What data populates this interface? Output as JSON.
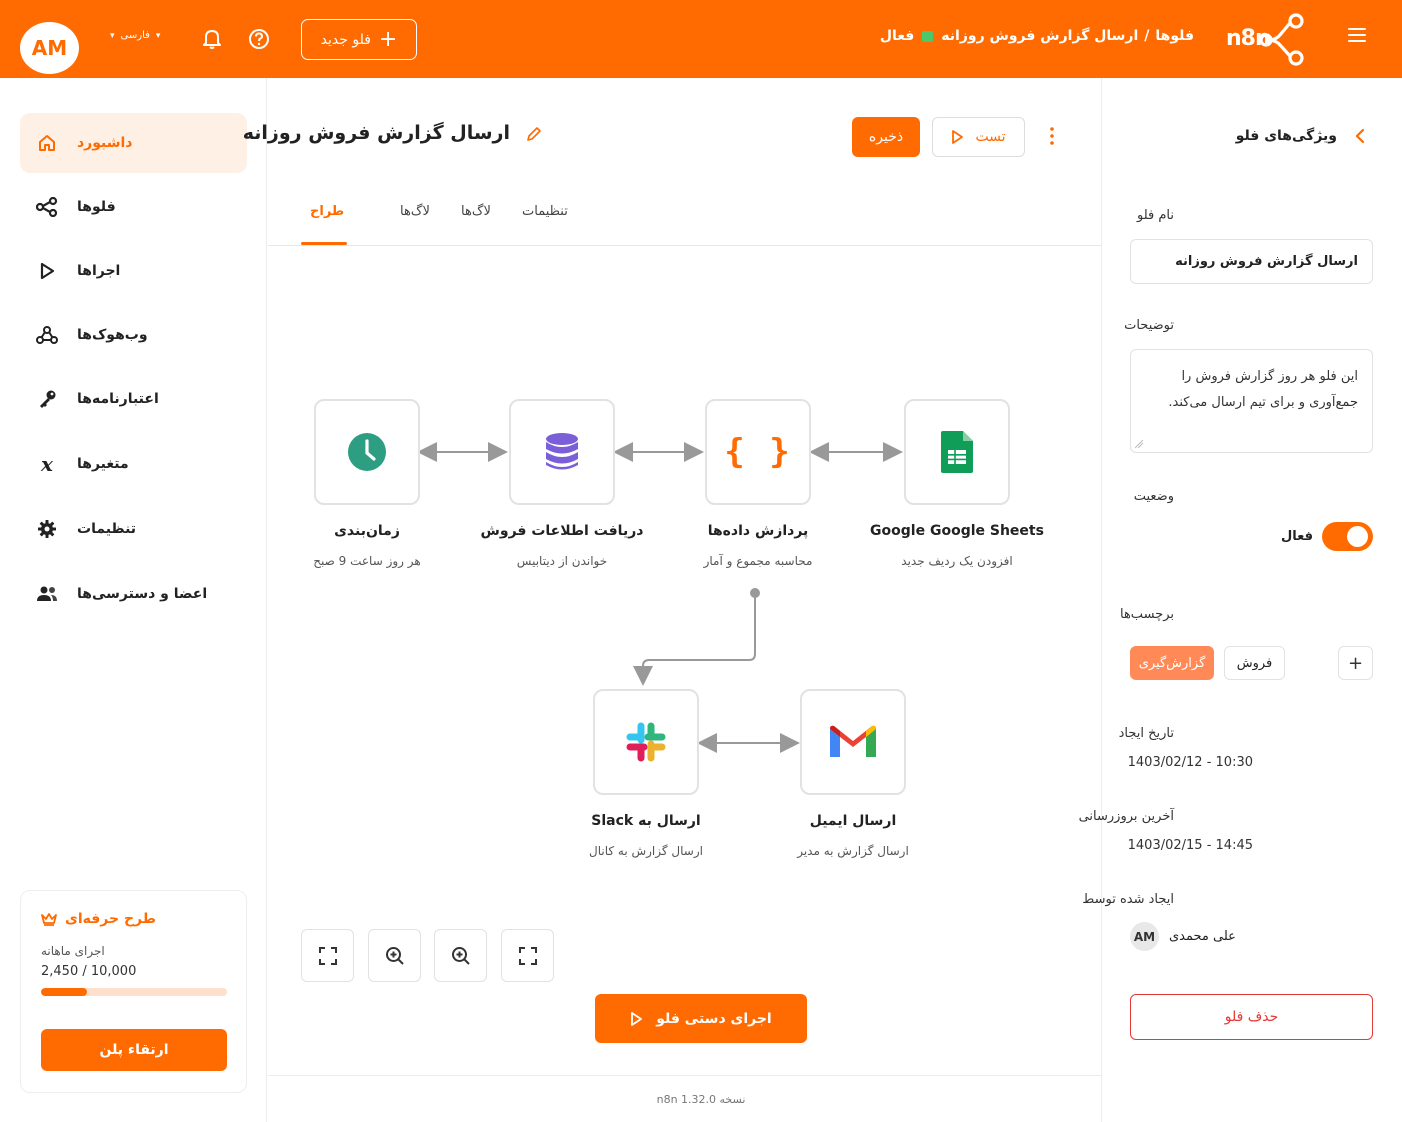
{
  "topbar": {
    "avatar_initials": "AM",
    "lang_label": "فارسی",
    "new_flow_label": "فلو جدید",
    "breadcrumb_parent": "فلوها",
    "breadcrumb_sep": "/",
    "breadcrumb_current": "ارسال گزارش فروش روزانه",
    "status_label": "فعال",
    "logo_text": "n8n",
    "icons": [
      "menu-icon",
      "bell-icon",
      "help-icon",
      "chevron-down-icon",
      "plus-icon"
    ]
  },
  "sidebar": {
    "items": [
      {
        "label": "داشبورد",
        "icon": "home-icon",
        "active": true
      },
      {
        "label": "فلوها",
        "icon": "share-icon"
      },
      {
        "label": "اجراها",
        "icon": "play-icon"
      },
      {
        "label": "وب‌هوک‌ها",
        "icon": "webhook-icon"
      },
      {
        "label": "اعتبارنامه‌ها",
        "icon": "key-icon"
      },
      {
        "label": "متغیرها",
        "icon": "variable-icon"
      },
      {
        "label": "تنظیمات",
        "icon": "gear-icon"
      },
      {
        "label": "اعضا و دسترسی‌ها",
        "icon": "users-icon"
      }
    ],
    "plan": {
      "title": "طرح حرفه‌ای",
      "subtitle": "اجرای ماهانه",
      "usage_text": "2,450 / 10,000",
      "usage_fraction": 0.245,
      "upgrade_label": "ارتقاء پلن"
    }
  },
  "main": {
    "flow_title": "ارسال گزارش فروش روزانه",
    "test_label": "تست",
    "save_label": "ذخیره",
    "tabs": [
      {
        "label": "طراح",
        "active": true
      },
      {
        "label": "لاگ‌ها"
      },
      {
        "label": "لاگ‌ها"
      },
      {
        "label": "تنظیمات"
      }
    ],
    "nodes": [
      {
        "title": "زمان‌بندی",
        "subtitle": "هر روز ساعت 9 صبح",
        "icon": "clock-icon"
      },
      {
        "title": "دریافت اطلاعات فروش",
        "subtitle": "خواندن از دیتابیس",
        "icon": "database-icon"
      },
      {
        "title": "پردازش داده‌ها",
        "subtitle": "محاسبه مجموع و آمار",
        "icon": "code-braces-icon"
      },
      {
        "title": "Google Google Sheets",
        "subtitle": "افزودن یک ردیف جدید",
        "icon": "google-sheets-icon"
      },
      {
        "title": "ارسال به Slack",
        "subtitle": "ارسال گزارش به کانال",
        "icon": "slack-icon"
      },
      {
        "title": "ارسال ایمیل",
        "subtitle": "ارسال گزارش به مدیر",
        "icon": "gmail-icon"
      }
    ],
    "zoom_controls": [
      "fit-view-icon",
      "zoom-in-icon",
      "zoom-out-icon",
      "fullscreen-icon"
    ],
    "run_label": "اجرای دستی فلو",
    "version_text": "نسخه n8n 1.32.0"
  },
  "props": {
    "title": "ویژگی‌های فلو",
    "name_label": "نام فلو",
    "name_value": "ارسال گزارش فروش روزانه",
    "desc_label": "توضیحات",
    "desc_line1": "این فلو هر روز گزارش فروش را",
    "desc_line2": "جمع‌آوری و برای تیم ارسال می‌کند.",
    "status_label": "وضعیت",
    "status_value": "فعال",
    "status_on": true,
    "tags_label": "برچسب‌ها",
    "tags": [
      "گزارش‌گیری",
      "فروش"
    ],
    "add_tag": "+",
    "created_label": "تاریخ ایجاد",
    "created_value": "1403/02/12 - 10:30",
    "updated_label": "آخرین بروزرسانی",
    "updated_value": "1403/02/15 - 14:45",
    "creator_label": "ایجاد شده توسط",
    "creator_initials": "AM",
    "creator_name": "علی محمدی",
    "delete_label": "حذف فلو"
  },
  "colors": {
    "accent": "#ff6b00",
    "tag_accent": "#ff8a57",
    "danger": "#e53935",
    "status_green": "#4cc86a"
  }
}
